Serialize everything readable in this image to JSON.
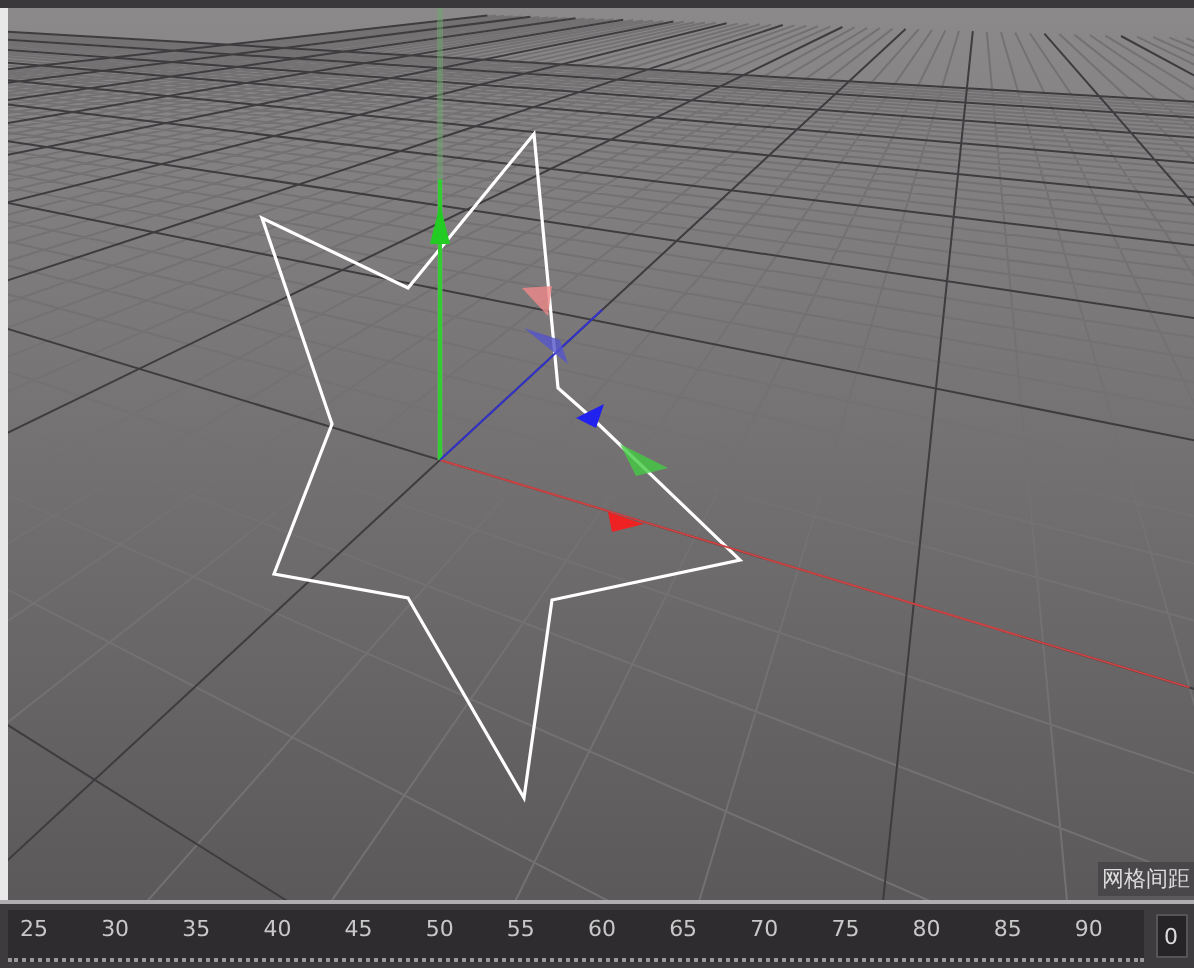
{
  "viewport": {
    "overlay_label": "网格间距"
  },
  "timeline": {
    "ticks": [
      "25",
      "30",
      "35",
      "40",
      "45",
      "50",
      "55",
      "60",
      "65",
      "70",
      "75",
      "80",
      "85",
      "90"
    ],
    "frame": "0"
  }
}
